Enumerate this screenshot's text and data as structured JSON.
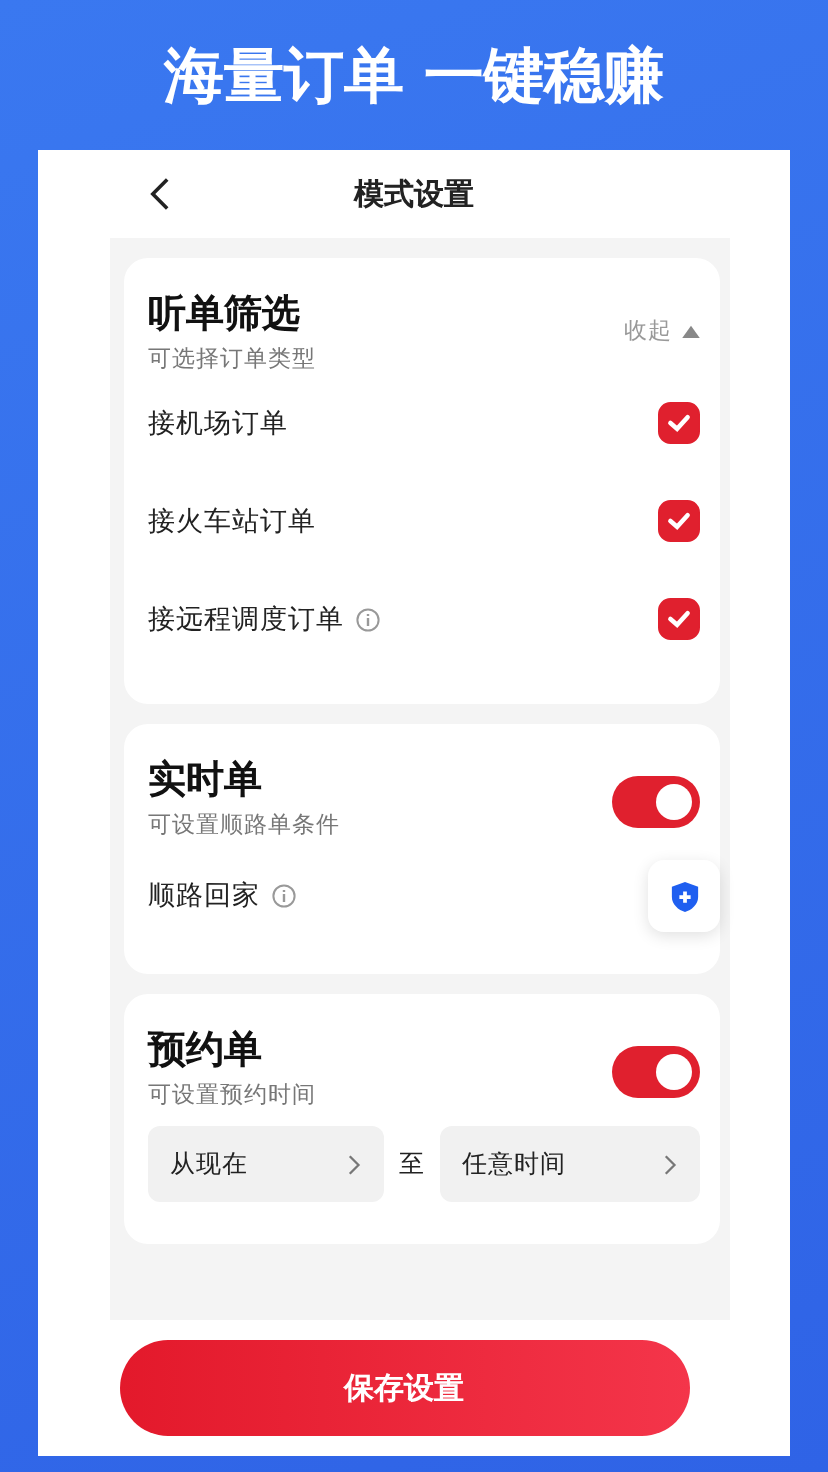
{
  "headline": "海量订单 一键稳赚",
  "nav": {
    "title": "模式设置"
  },
  "filter": {
    "title": "听单筛选",
    "subtitle": "可选择订单类型",
    "collapse": "收起",
    "expanded": true,
    "options": [
      {
        "label": "接机场订单",
        "info": false,
        "checked": true
      },
      {
        "label": "接火车站订单",
        "info": false,
        "checked": true
      },
      {
        "label": "接远程调度订单",
        "info": true,
        "checked": true
      }
    ]
  },
  "realtime": {
    "title": "实时单",
    "subtitle": "可设置顺路单条件",
    "on": true,
    "home": {
      "label": "顺路回家",
      "info": true
    }
  },
  "reserve": {
    "title": "预约单",
    "subtitle": "可设置预约时间",
    "on": true,
    "from": "从现在",
    "to_label": "至",
    "to": "任意时间"
  },
  "save_button": "保存设置"
}
